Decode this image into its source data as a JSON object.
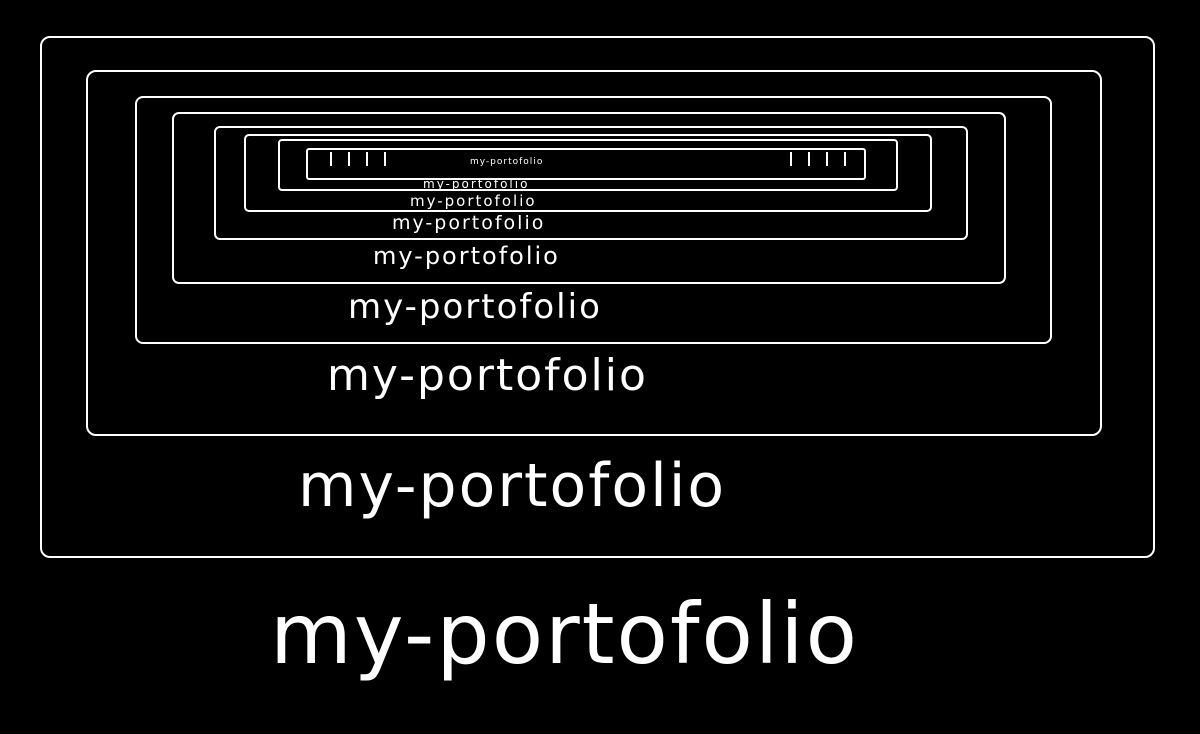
{
  "caption": "my-portofolio",
  "nested_captions": [
    "my-portofolio",
    "my-portofolio",
    "my-portofolio",
    "my-portofolio",
    "my-portofolio",
    "my-portofolio",
    "my-portofolio"
  ],
  "colors": {
    "background": "#000000",
    "foreground": "#ffffff"
  }
}
